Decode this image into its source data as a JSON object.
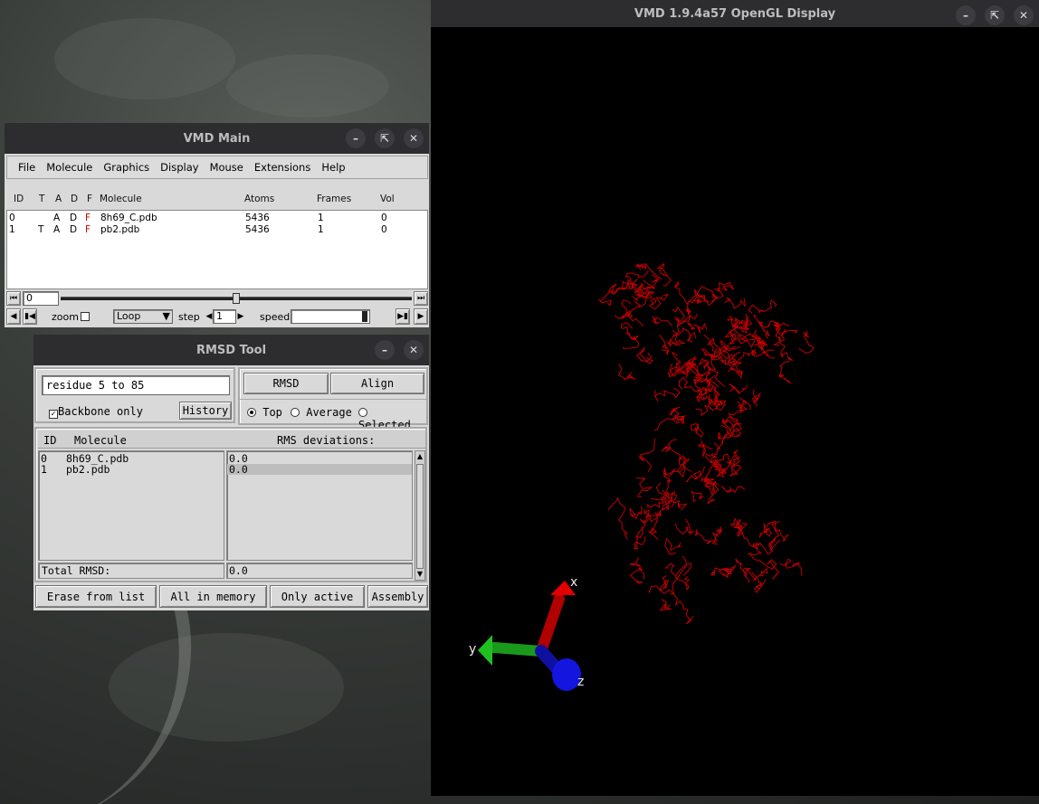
{
  "gl_window": {
    "title": "VMD 1.9.4a57 OpenGL Display",
    "axes": {
      "x": "x",
      "y": "y",
      "z": "z"
    },
    "molecule_color": "#c00000"
  },
  "vmd_main": {
    "title": "VMD Main",
    "menu": [
      "File",
      "Molecule",
      "Graphics",
      "Display",
      "Mouse",
      "Extensions",
      "Help"
    ],
    "columns": {
      "id": "ID",
      "t": "T",
      "a": "A",
      "d": "D",
      "f": "F",
      "molecule": "Molecule",
      "atoms": "Atoms",
      "frames": "Frames",
      "vol": "Vol"
    },
    "molecules": [
      {
        "id": "0",
        "t": "",
        "a": "A",
        "d": "D",
        "f": "F",
        "name": "8h69_C.pdb",
        "atoms": "5436",
        "frames": "1",
        "vol": "0"
      },
      {
        "id": "1",
        "t": "T",
        "a": "A",
        "d": "D",
        "f": "F",
        "name": "pb2.pdb",
        "atoms": "5436",
        "frames": "1",
        "vol": "0"
      }
    ],
    "frame_value": "0",
    "zoom_label": "zoom",
    "loop_mode": "Loop",
    "step_label": "step",
    "step_value": "1",
    "speed_label": "speed"
  },
  "rmsd_tool": {
    "title": "RMSD Tool",
    "selection": "residue 5 to 85",
    "backbone_label": "Backbone only",
    "history_button": "History",
    "rmsd_button": "RMSD",
    "align_button": "Align",
    "radio_top": "Top",
    "radio_average": "Average",
    "radio_selected": "Selected",
    "list_header_id": "ID",
    "list_header_molecule": "Molecule",
    "list_header_rms": "RMS deviations:",
    "rows": [
      {
        "id": "0",
        "name": "8h69_C.pdb",
        "rms": "0.0"
      },
      {
        "id": "1",
        "name": "pb2.pdb",
        "rms": "0.0"
      }
    ],
    "total_label": "Total RMSD:",
    "total_value": "0.0",
    "erase_button": "Erase from list",
    "all_button": "All in memory",
    "active_button": "Only active",
    "assembly_button": "Assembly"
  }
}
